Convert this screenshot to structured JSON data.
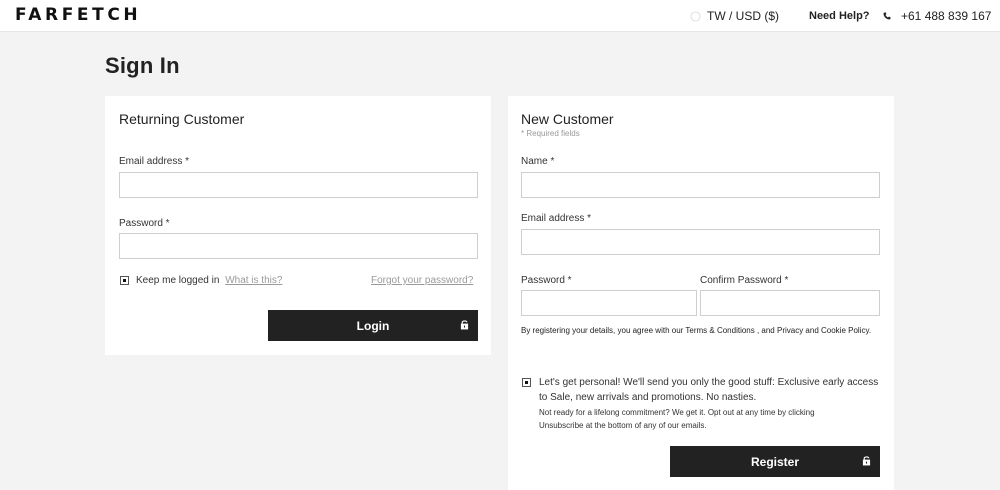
{
  "header": {
    "logo": "FARFETCH",
    "region": "TW / USD ($)",
    "help": "Need Help?",
    "phone": "+61 488 839 167"
  },
  "page": {
    "title": "Sign In"
  },
  "returning": {
    "title": "Returning Customer",
    "email_label": "Email address *",
    "email_value": "",
    "password_label": "Password *",
    "password_value": "",
    "keep_label": "Keep me logged in",
    "keep_checked": true,
    "whatis": "What is this?",
    "forgot": "Forgot your password?",
    "login_label": "Login"
  },
  "new_customer": {
    "title": "New Customer",
    "required_note": "* Required fields",
    "name_label": "Name *",
    "email_label": "Email address *",
    "password_label": "Password *",
    "confirm_label": "Confirm Password *",
    "terms": "By registering your details, you agree with our Terms & Conditions , and Privacy and Cookie Policy.",
    "optin_checked": true,
    "optin_text": "Let's get personal! We'll send you only the good stuff: Exclusive early access to Sale, new arrivals and promotions. No nasties.",
    "optin_small": "Not ready for a lifelong commitment? We get it. Opt out at any time by clicking Unsubscribe at the bottom of any of our emails.",
    "register_label": "Register"
  },
  "colors": {
    "background": "#f3f3f3",
    "panel": "#ffffff",
    "button": "#222222",
    "muted_link": "#9a9a9a"
  }
}
